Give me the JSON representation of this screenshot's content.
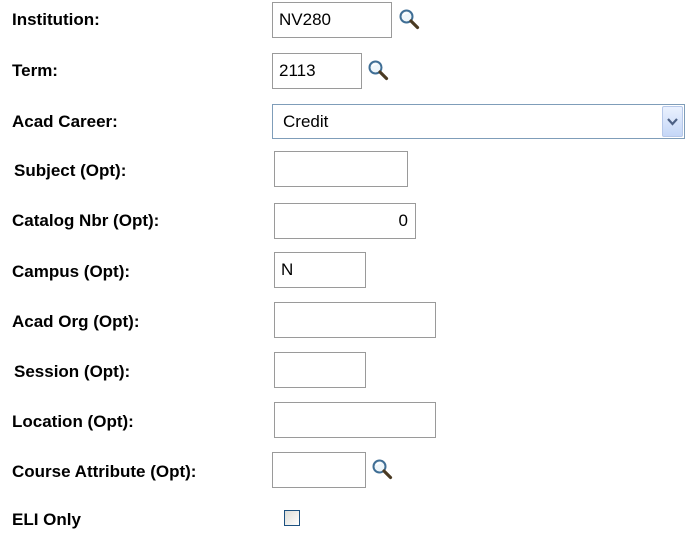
{
  "form": {
    "institution": {
      "label": "Institution:",
      "value": "NV280",
      "lookup_icon": "magnifier-icon"
    },
    "term": {
      "label": "Term:",
      "value": "2113",
      "lookup_icon": "magnifier-icon"
    },
    "acad_career": {
      "label": "Acad Career:",
      "selected": "Credit",
      "arrow_icon": "chevron-down-icon"
    },
    "subject": {
      "label": "Subject (Opt):",
      "value": ""
    },
    "catalog_nbr": {
      "label": "Catalog Nbr (Opt):",
      "value": "0"
    },
    "campus": {
      "label": "Campus (Opt):",
      "value": "N"
    },
    "acad_org": {
      "label": "Acad Org (Opt):",
      "value": ""
    },
    "session": {
      "label": "Session (Opt):",
      "value": ""
    },
    "location": {
      "label": "Location (Opt):",
      "value": ""
    },
    "course_attribute": {
      "label": "Course Attribute (Opt):",
      "value": "",
      "lookup_icon": "magnifier-icon"
    },
    "eli_only": {
      "label": "ELI Only",
      "checked": false
    }
  }
}
